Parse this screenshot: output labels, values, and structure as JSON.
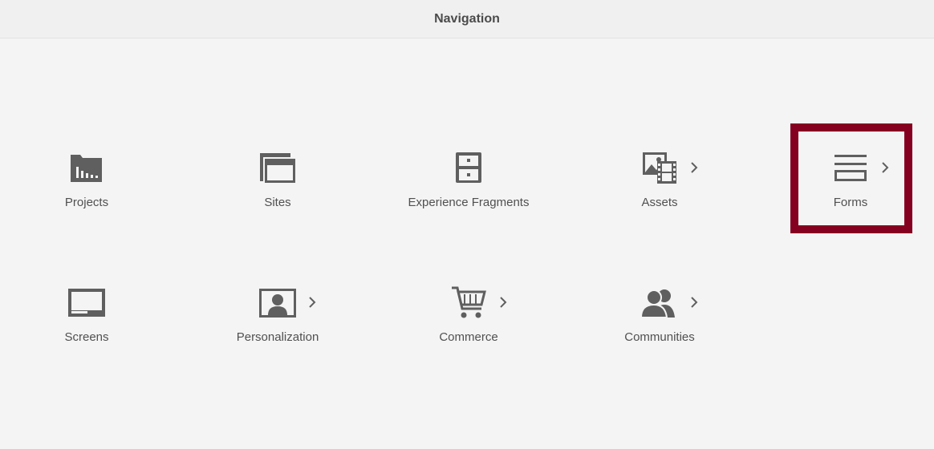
{
  "header": {
    "title": "Navigation"
  },
  "tiles": [
    {
      "label": "Projects",
      "icon": "projects-folder-icon",
      "has_submenu": false
    },
    {
      "label": "Sites",
      "icon": "sites-windows-icon",
      "has_submenu": false
    },
    {
      "label": "Experience Fragments",
      "icon": "experience-fragments-cabinet-icon",
      "has_submenu": false
    },
    {
      "label": "Assets",
      "icon": "assets-image-film-icon",
      "has_submenu": true
    },
    {
      "label": "Forms",
      "icon": "forms-lines-icon",
      "has_submenu": true,
      "selected": true
    },
    {
      "label": "Screens",
      "icon": "screens-monitor-icon",
      "has_submenu": false
    },
    {
      "label": "Personalization",
      "icon": "personalization-portrait-icon",
      "has_submenu": true
    },
    {
      "label": "Commerce",
      "icon": "commerce-cart-icon",
      "has_submenu": true
    },
    {
      "label": "Communities",
      "icon": "communities-people-icon",
      "has_submenu": true
    }
  ],
  "colors": {
    "background": "#f4f4f4",
    "icon": "#5f5f5f",
    "label": "#505050",
    "selection_border": "#850020"
  }
}
